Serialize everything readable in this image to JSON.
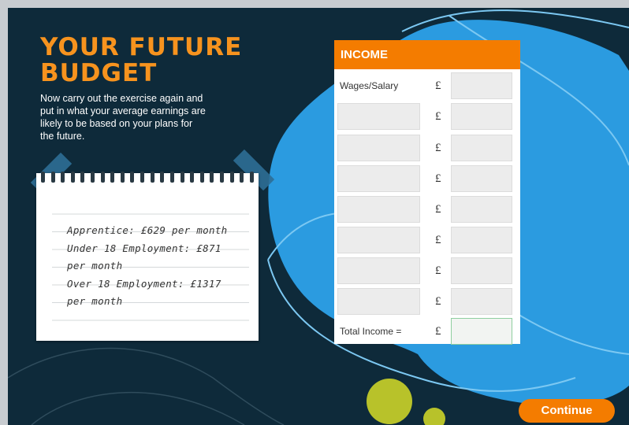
{
  "title": {
    "line1": "YOUR FUTURE",
    "line2": "BUDGET"
  },
  "intro": "Now carry out the exercise again and put in what your average earnings are likely to be based on your plans for the future.",
  "notepad": {
    "lines": [
      "Apprentice: £629 per month",
      "Under 18 Employment: £871",
      "per month",
      "Over 18 Employment: £1317",
      "per month"
    ]
  },
  "income": {
    "header": "INCOME",
    "currency": "£",
    "first_row_label": "Wages/Salary",
    "total_label": "Total Income ="
  },
  "continue_label": "Continue",
  "colors": {
    "background": "#0e2a3a",
    "accent_orange": "#f47c00",
    "blob_blue": "#2b9be0",
    "lime": "#b8c22a"
  }
}
